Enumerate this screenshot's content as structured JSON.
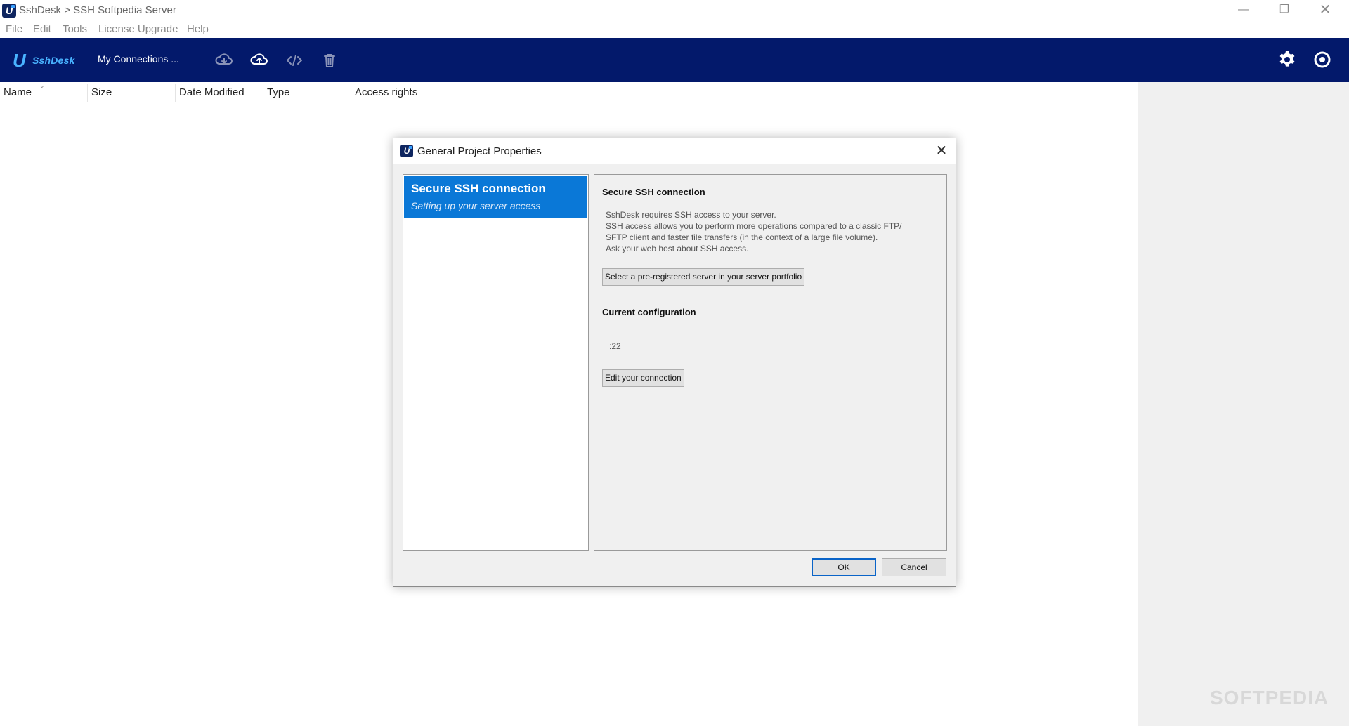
{
  "window": {
    "title": "SshDesk > SSH Softpedia Server",
    "minimize_glyph": "—",
    "maximize_glyph": "❐",
    "close_glyph": "✕"
  },
  "menu": {
    "items": [
      "File",
      "Edit",
      "Tools",
      "License Upgrade",
      "Help"
    ]
  },
  "toolbar": {
    "brand_mark": "U",
    "brand": "SshDesk",
    "connections_label": "My Connections ...",
    "icons": [
      "cloud-download-icon",
      "cloud-upload-icon",
      "code-icon",
      "trash-icon",
      "gear-icon",
      "power-icon"
    ]
  },
  "file_list": {
    "columns": [
      "Name",
      "Size",
      "Date Modified",
      "Type",
      "Access rights"
    ],
    "sort_glyph": "⌄"
  },
  "watermark": "SOFTPEDIA",
  "dialog": {
    "title": "General Project Properties",
    "close_glyph": "✕",
    "nav": {
      "items": [
        {
          "title": "Secure SSH connection",
          "subtitle": "Setting up your server access"
        }
      ]
    },
    "content": {
      "heading": "Secure SSH connection",
      "description": [
        "SshDesk requires SSH access to your server.",
        "SSH access allows you to perform more operations compared to a classic FTP/",
        "SFTP client and faster file transfers (in the context of a large file volume).",
        "Ask your web host about SSH access."
      ],
      "select_server_label": "Select a pre-registered server in your server portfolio",
      "config_heading": "Current configuration",
      "config_value": ":22",
      "edit_connection_label": "Edit your connection"
    },
    "ok_label": "OK",
    "cancel_label": "Cancel"
  },
  "colors": {
    "toolbar_bg": "#03196b",
    "brand_accent": "#49b3ff",
    "selection": "#0a78d7"
  }
}
